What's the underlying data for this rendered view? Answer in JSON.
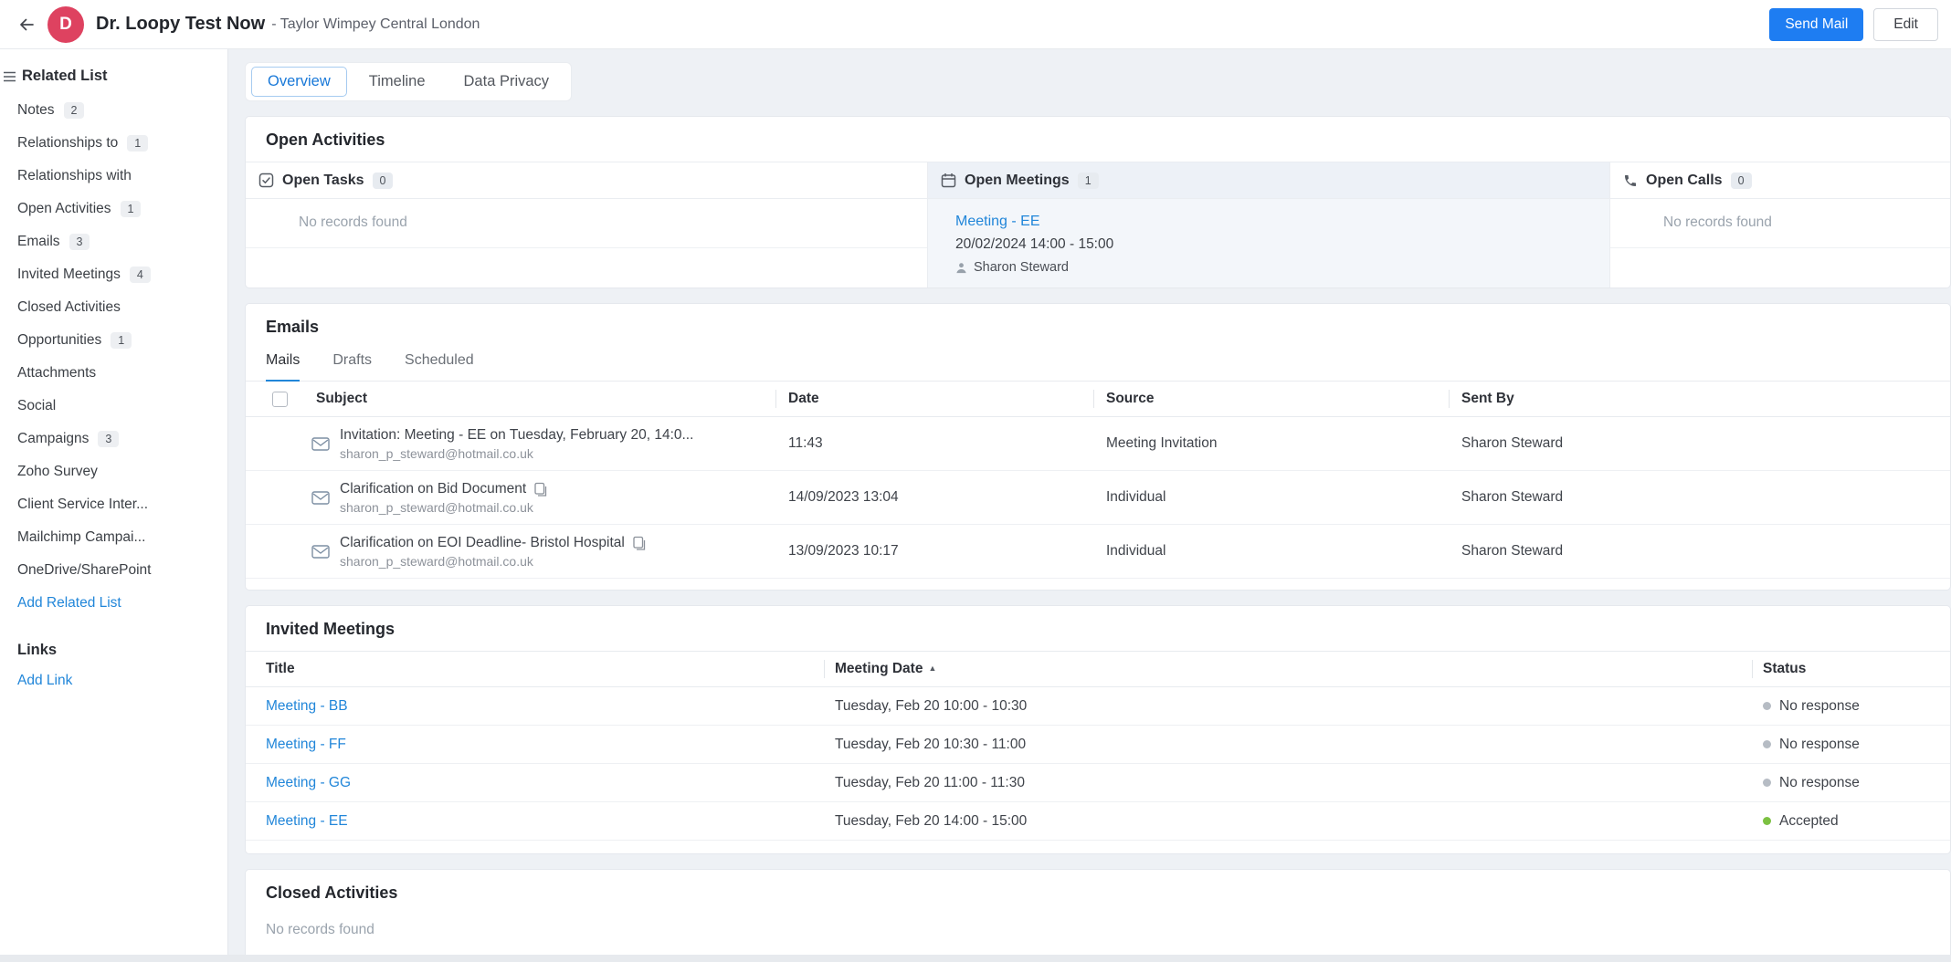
{
  "header": {
    "avatar_letter": "D",
    "title": "Dr. Loopy Test Now",
    "subtitle": "- Taylor Wimpey Central London",
    "send_mail_label": "Send Mail",
    "edit_label": "Edit"
  },
  "sidebar": {
    "related_list_title": "Related List",
    "items": [
      {
        "label": "Notes",
        "count": "2"
      },
      {
        "label": "Relationships to",
        "count": "1"
      },
      {
        "label": "Relationships with",
        "count": ""
      },
      {
        "label": "Open Activities",
        "count": "1"
      },
      {
        "label": "Emails",
        "count": "3"
      },
      {
        "label": "Invited Meetings",
        "count": "4"
      },
      {
        "label": "Closed Activities",
        "count": ""
      },
      {
        "label": "Opportunities",
        "count": "1"
      },
      {
        "label": "Attachments",
        "count": ""
      },
      {
        "label": "Social",
        "count": ""
      },
      {
        "label": "Campaigns",
        "count": "3"
      },
      {
        "label": "Zoho Survey",
        "count": ""
      },
      {
        "label": "Client Service Inter...",
        "count": ""
      },
      {
        "label": "Mailchimp Campai...",
        "count": ""
      },
      {
        "label": "OneDrive/SharePoint",
        "count": ""
      }
    ],
    "add_related_list": "Add Related List",
    "links_title": "Links",
    "add_link": "Add Link"
  },
  "tabs": [
    {
      "label": "Overview"
    },
    {
      "label": "Timeline"
    },
    {
      "label": "Data Privacy"
    }
  ],
  "open_activities": {
    "title": "Open Activities",
    "tasks": {
      "label": "Open Tasks",
      "count": "0",
      "empty": "No records found"
    },
    "meetings": {
      "label": "Open Meetings",
      "count": "1",
      "item": {
        "title": "Meeting - EE",
        "datetime": "20/02/2024 14:00 - 15:00",
        "person": "Sharon Steward"
      }
    },
    "calls": {
      "label": "Open Calls",
      "count": "0",
      "empty": "No records found"
    }
  },
  "emails": {
    "title": "Emails",
    "tabs": [
      "Mails",
      "Drafts",
      "Scheduled"
    ],
    "columns": [
      "Subject",
      "Date",
      "Source",
      "Sent By"
    ],
    "rows": [
      {
        "subject": "Invitation: Meeting - EE on Tuesday, February 20, 14:0...",
        "email": "sharon_p_steward@hotmail.co.uk",
        "date": "11:43",
        "source": "Meeting Invitation",
        "sent_by": "Sharon Steward"
      },
      {
        "subject": "Clarification on Bid Document",
        "email": "sharon_p_steward@hotmail.co.uk",
        "date": "14/09/2023 13:04",
        "source": "Individual",
        "sent_by": "Sharon Steward"
      },
      {
        "subject": "Clarification on EOI Deadline- Bristol Hospital",
        "email": "sharon_p_steward@hotmail.co.uk",
        "date": "13/09/2023 10:17",
        "source": "Individual",
        "sent_by": "Sharon Steward"
      }
    ]
  },
  "invited_meetings": {
    "title": "Invited Meetings",
    "columns": [
      "Title",
      "Meeting Date",
      "Status"
    ],
    "sort_icon": "▲",
    "rows": [
      {
        "title": "Meeting - BB",
        "date": "Tuesday, Feb 20 10:00 - 10:30",
        "status": "No response",
        "status_color": "#b6bcc4"
      },
      {
        "title": "Meeting - FF",
        "date": "Tuesday, Feb 20 10:30 - 11:00",
        "status": "No response",
        "status_color": "#b6bcc4"
      },
      {
        "title": "Meeting - GG",
        "date": "Tuesday, Feb 20 11:00 - 11:30",
        "status": "No response",
        "status_color": "#b6bcc4"
      },
      {
        "title": "Meeting - EE",
        "date": "Tuesday, Feb 20 14:00 - 15:00",
        "status": "Accepted",
        "status_color": "#7cc142"
      }
    ]
  },
  "closed_activities": {
    "title": "Closed Activities",
    "empty": "No records found"
  },
  "colors": {
    "accent_blue": "#1e7df2",
    "link_blue": "#2186d9",
    "avatar_bg": "#de4260",
    "status_green": "#7cc142",
    "status_gray": "#b6bcc4"
  }
}
